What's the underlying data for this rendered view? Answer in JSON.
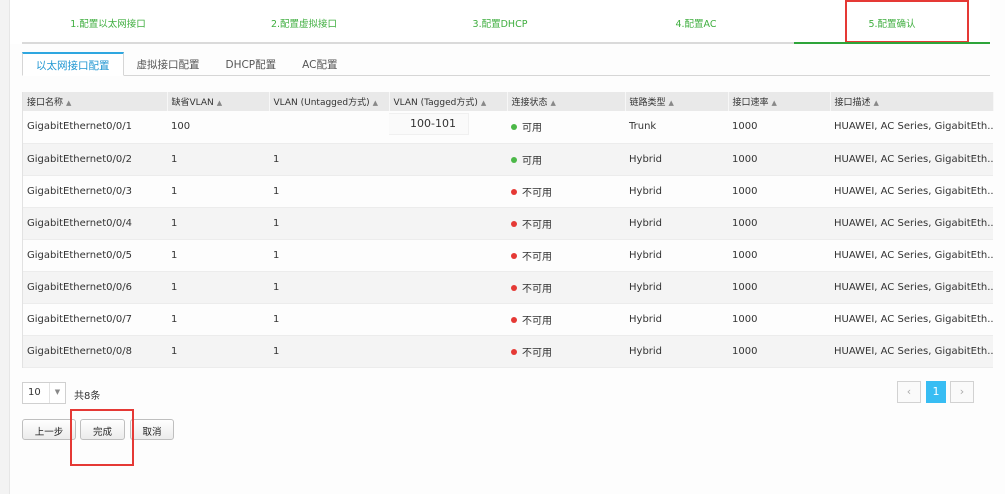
{
  "wizard": {
    "steps": [
      "1.配置以太网接口",
      "2.配置虚拟接口",
      "3.配置DHCP",
      "4.配置AC",
      "5.配置确认"
    ]
  },
  "tabs": [
    "以太网接口配置",
    "虚拟接口配置",
    "DHCP配置",
    "AC配置"
  ],
  "table": {
    "columns": [
      "接口名称",
      "缺省VLAN",
      "VLAN (Untagged方式)",
      "VLAN (Tagged方式)",
      "连接状态",
      "链路类型",
      "接口速率",
      "接口描述"
    ],
    "rows": [
      {
        "name": "GigabitEthernet0/0/1",
        "pvid": "100",
        "untagged": "",
        "tagged": "100-101",
        "status": "可用",
        "link": "Trunk",
        "speed": "1000",
        "desc": "HUAWEI, AC Series, GigabitEth..."
      },
      {
        "name": "GigabitEthernet0/0/2",
        "pvid": "1",
        "untagged": "1",
        "tagged": "",
        "status": "可用",
        "link": "Hybrid",
        "speed": "1000",
        "desc": "HUAWEI, AC Series, GigabitEth..."
      },
      {
        "name": "GigabitEthernet0/0/3",
        "pvid": "1",
        "untagged": "1",
        "tagged": "",
        "status": "不可用",
        "link": "Hybrid",
        "speed": "1000",
        "desc": "HUAWEI, AC Series, GigabitEth..."
      },
      {
        "name": "GigabitEthernet0/0/4",
        "pvid": "1",
        "untagged": "1",
        "tagged": "",
        "status": "不可用",
        "link": "Hybrid",
        "speed": "1000",
        "desc": "HUAWEI, AC Series, GigabitEth..."
      },
      {
        "name": "GigabitEthernet0/0/5",
        "pvid": "1",
        "untagged": "1",
        "tagged": "",
        "status": "不可用",
        "link": "Hybrid",
        "speed": "1000",
        "desc": "HUAWEI, AC Series, GigabitEth..."
      },
      {
        "name": "GigabitEthernet0/0/6",
        "pvid": "1",
        "untagged": "1",
        "tagged": "",
        "status": "不可用",
        "link": "Hybrid",
        "speed": "1000",
        "desc": "HUAWEI, AC Series, GigabitEth..."
      },
      {
        "name": "GigabitEthernet0/0/7",
        "pvid": "1",
        "untagged": "1",
        "tagged": "",
        "status": "不可用",
        "link": "Hybrid",
        "speed": "1000",
        "desc": "HUAWEI, AC Series, GigabitEth..."
      },
      {
        "name": "GigabitEthernet0/0/8",
        "pvid": "1",
        "untagged": "1",
        "tagged": "",
        "status": "不可用",
        "link": "Hybrid",
        "speed": "1000",
        "desc": "HUAWEI, AC Series, GigabitEth..."
      }
    ]
  },
  "pager": {
    "page_size": "10",
    "total": "共8条",
    "current_page": "1",
    "prev": "‹",
    "next": "›"
  },
  "buttons": {
    "prev": "上一步",
    "finish": "完成",
    "cancel": "取消"
  },
  "icons": {
    "sort": "sort-asc-icon",
    "caret": "caret-down-icon"
  }
}
